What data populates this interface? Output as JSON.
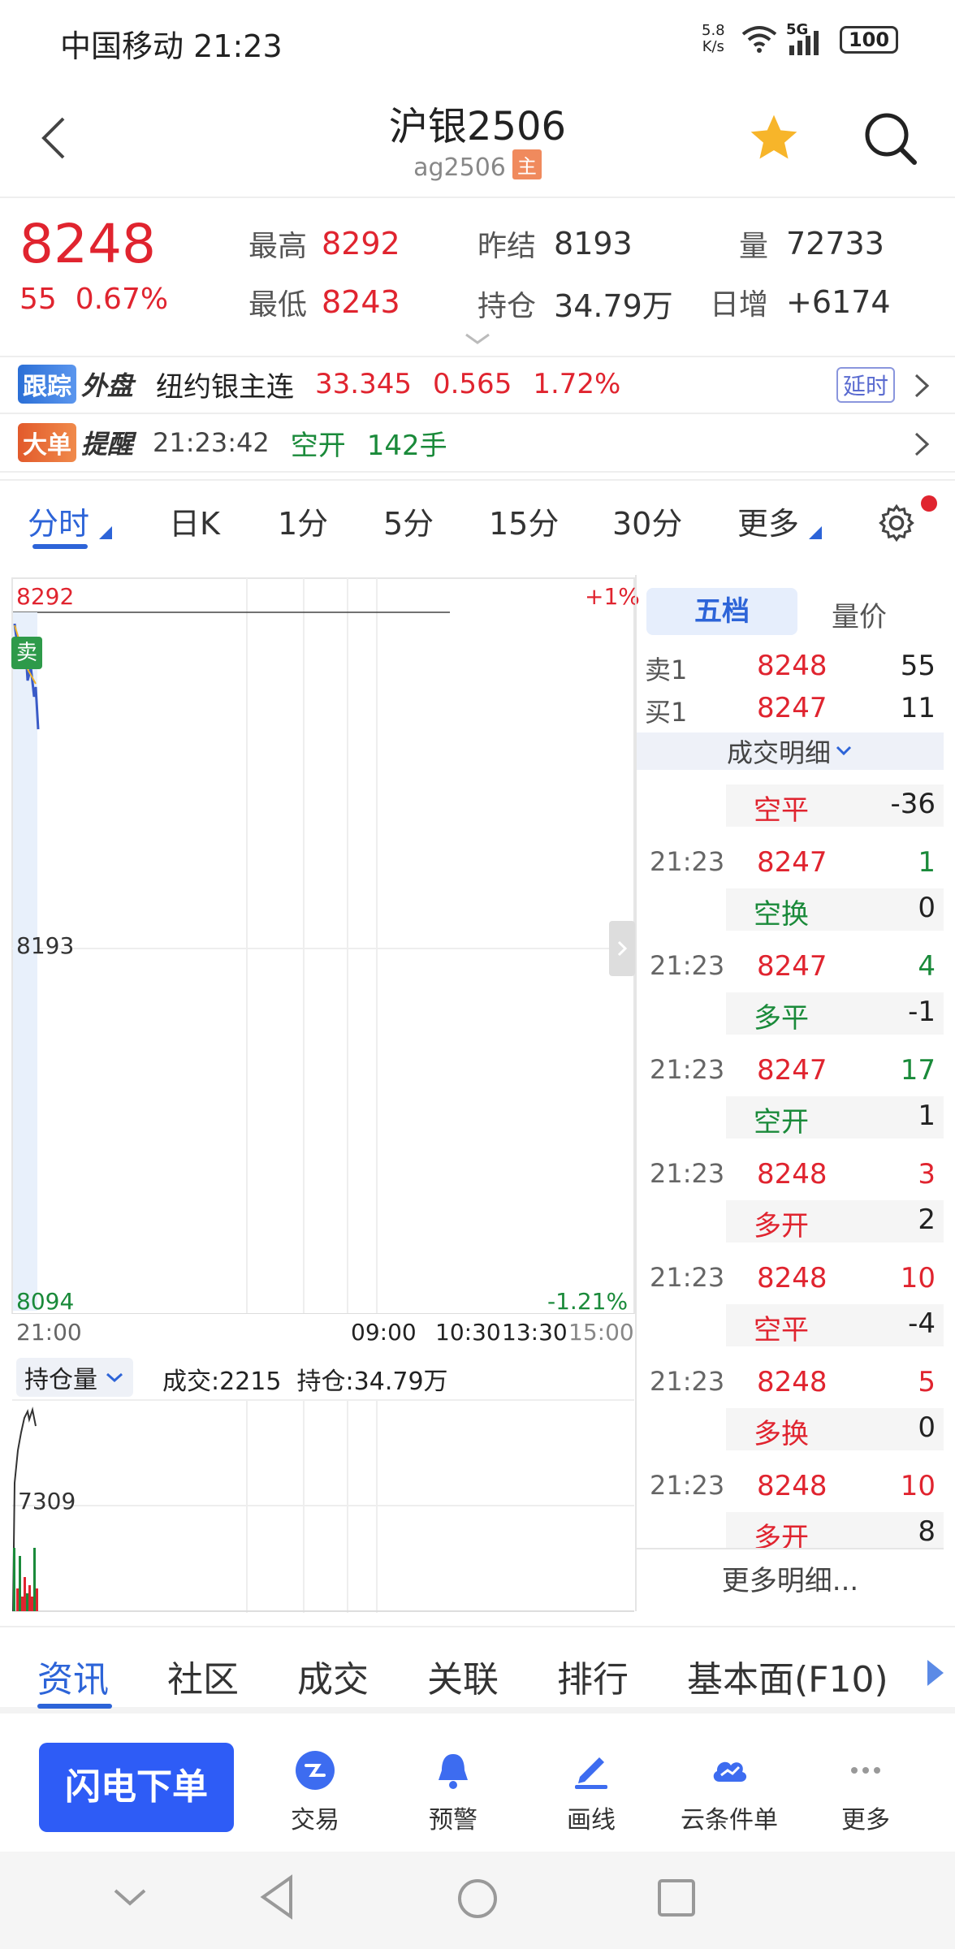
{
  "status_bar": {
    "carrier": "中国移动",
    "time": "21:23",
    "net_speed_value": "5.8",
    "net_speed_unit": "K/s",
    "network": "5G",
    "battery": "100"
  },
  "header": {
    "title": "沪银2506",
    "code": "ag2506",
    "tag": "主"
  },
  "quote": {
    "price": "8248",
    "change": "55",
    "change_pct": "0.67%",
    "high_label": "最高",
    "high": "8292",
    "low_label": "最低",
    "low": "8243",
    "prev_settle_label": "昨结",
    "prev_settle": "8193",
    "open_interest_label": "持仓",
    "open_interest": "34.79万",
    "volume_label": "量",
    "volume": "72733",
    "daily_inc_label": "日增",
    "daily_inc": "+6174"
  },
  "foreign": {
    "badge1": "跟踪",
    "badge2": "外盘",
    "name": "纽约银主连",
    "price": "33.345",
    "change": "0.565",
    "pct": "1.72%",
    "delay_tag": "延时"
  },
  "alert": {
    "badge1": "大单",
    "badge2": "提醒",
    "time": "21:23:42",
    "type": "空开",
    "qty": "142手"
  },
  "tabs": [
    "分时",
    "日K",
    "1分",
    "5分",
    "15分",
    "30分",
    "更多"
  ],
  "chart": {
    "y_high": "8292",
    "y_mid": "8193",
    "y_low": "8094",
    "pct_high": "+1%",
    "pct_low": "-1.21%",
    "x_ticks": [
      "21:00",
      "09:00",
      "10:30",
      "13:30",
      "15:00"
    ],
    "sell_marker": "卖",
    "sub_selector": "持仓量",
    "sub_volume": "成交:2215",
    "sub_oi": "持仓:34.79万",
    "sub_y": "7309"
  },
  "order_book": {
    "tab_active": "五档",
    "tab_other": "量价",
    "asks": [
      {
        "label": "卖1",
        "price": "8248",
        "qty": "55"
      }
    ],
    "bids": [
      {
        "label": "买1",
        "price": "8247",
        "qty": "11"
      }
    ],
    "detail_title": "成交明细",
    "first_type": "空平",
    "first_qty": "-36",
    "trades": [
      {
        "time": "21:23",
        "price": "8247",
        "vol": "1",
        "type": "空换",
        "oi": "0"
      },
      {
        "time": "21:23",
        "price": "8247",
        "vol": "4",
        "type": "多平",
        "oi": "-1"
      },
      {
        "time": "21:23",
        "price": "8247",
        "vol": "17",
        "type": "空开",
        "oi": "1"
      },
      {
        "time": "21:23",
        "price": "8248",
        "vol": "3",
        "type": "多开",
        "oi": "2"
      },
      {
        "time": "21:23",
        "price": "8248",
        "vol": "10",
        "type": "空平",
        "oi": "-4"
      },
      {
        "time": "21:23",
        "price": "8248",
        "vol": "5",
        "type": "多换",
        "oi": "0"
      },
      {
        "time": "21:23",
        "price": "8248",
        "vol": "10",
        "type": "多开",
        "oi": "8"
      }
    ],
    "more": "更多明细..."
  },
  "bottom_tabs": [
    "资讯",
    "社区",
    "成交",
    "关联",
    "排行",
    "基本面(F10)"
  ],
  "toolbar": {
    "flash": "闪电下单",
    "trade": "交易",
    "alert": "预警",
    "draw": "画线",
    "cloud": "云条件单",
    "more": "更多"
  },
  "colors": {
    "up": "#e0242f",
    "down": "#1a8a3a",
    "accent": "#2d64d8",
    "flash_button": "#2e5cf6"
  }
}
